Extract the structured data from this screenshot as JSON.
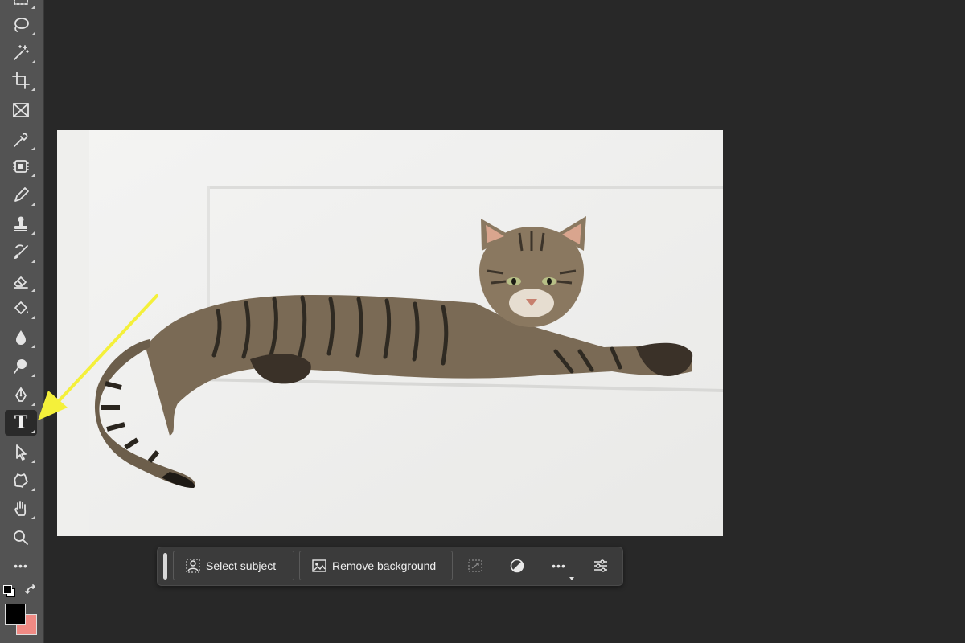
{
  "toolbar": {
    "tools": [
      {
        "name": "marquee-tool"
      },
      {
        "name": "lasso-tool"
      },
      {
        "name": "magic-wand-tool"
      },
      {
        "name": "crop-tool"
      },
      {
        "name": "frame-tool"
      },
      {
        "name": "eyedropper-tool"
      },
      {
        "name": "spot-healing-tool"
      },
      {
        "name": "brush-tool"
      },
      {
        "name": "clone-stamp-tool"
      },
      {
        "name": "history-brush-tool"
      },
      {
        "name": "eraser-tool"
      },
      {
        "name": "paint-bucket-tool"
      },
      {
        "name": "blur-tool"
      },
      {
        "name": "dodge-tool"
      },
      {
        "name": "pen-tool"
      },
      {
        "name": "type-tool",
        "active": true
      },
      {
        "name": "path-selection-tool"
      },
      {
        "name": "custom-shape-tool"
      },
      {
        "name": "hand-tool"
      },
      {
        "name": "zoom-tool"
      },
      {
        "name": "edit-toolbar-more"
      }
    ],
    "type_tool_glyph": "T",
    "more_glyph": "•••",
    "foreground_color": "#000000",
    "background_color": "#f08a84"
  },
  "canvas": {
    "image_subject": "tabby cat lying on white wall ledge"
  },
  "annotation": {
    "arrow_color": "#f4f03a",
    "points_to": "type-tool"
  },
  "contextual_taskbar": {
    "select_subject_label": "Select subject",
    "remove_background_label": "Remove background",
    "more_glyph": "•••"
  }
}
